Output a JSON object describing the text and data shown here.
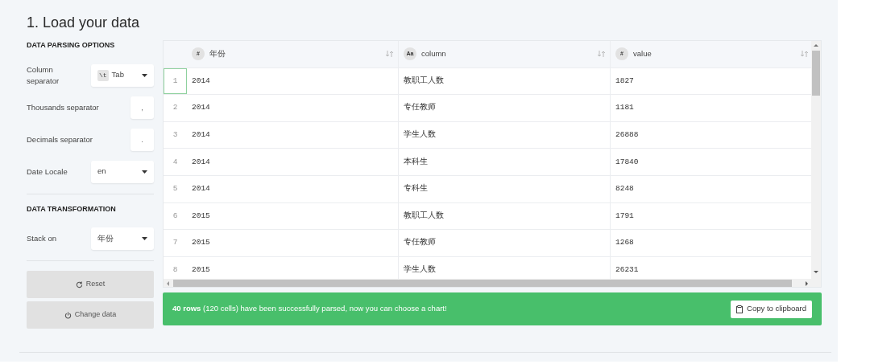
{
  "title": "1. Load your data",
  "sidebar": [
    {
      "heading": "DATA PARSING OPTIONS",
      "options": [
        {
          "kind": "select",
          "label": "Column separator",
          "badge": "\\t",
          "value": "Tab"
        },
        {
          "kind": "input",
          "label": "Thousands separator",
          "value": ","
        },
        {
          "kind": "input",
          "label": "Decimals separator",
          "value": "."
        },
        {
          "kind": "select",
          "label": "Date Locale",
          "value": "en"
        }
      ]
    },
    {
      "heading": "DATA TRANSFORMATION",
      "options": [
        {
          "kind": "select",
          "label": "Stack on",
          "value": "年份"
        }
      ]
    }
  ],
  "buttons": [
    {
      "kind": "reset",
      "label": "Reset"
    },
    {
      "kind": "change",
      "label": "Change data"
    }
  ],
  "table": {
    "columns": [
      {
        "type_badge": "#",
        "name": "年份"
      },
      {
        "type_badge": "Aa",
        "name": "column"
      },
      {
        "type_badge": "#",
        "name": "value"
      }
    ],
    "rows": [
      {
        "number": "1",
        "selected": true,
        "cells": [
          "2014",
          "教职工人数",
          "1827"
        ]
      },
      {
        "number": "2",
        "selected": false,
        "cells": [
          "2014",
          "专任教师",
          "1181"
        ]
      },
      {
        "number": "3",
        "selected": false,
        "cells": [
          "2014",
          "学生人数",
          "26888"
        ]
      },
      {
        "number": "4",
        "selected": false,
        "cells": [
          "2014",
          "本科生",
          "17840"
        ]
      },
      {
        "number": "5",
        "selected": false,
        "cells": [
          "2014",
          "专科生",
          "8248"
        ]
      },
      {
        "number": "6",
        "selected": false,
        "cells": [
          "2015",
          "教职工人数",
          "1791"
        ]
      },
      {
        "number": "7",
        "selected": false,
        "cells": [
          "2015",
          "专任教师",
          "1268"
        ]
      },
      {
        "number": "8",
        "selected": false,
        "cells": [
          "2015",
          "学生人数",
          "26231"
        ]
      }
    ]
  },
  "status": {
    "message": "**40 rows** (120 cells) have been successfully parsed, now you can choose a chart!",
    "button": "Copy to clipboard"
  }
}
